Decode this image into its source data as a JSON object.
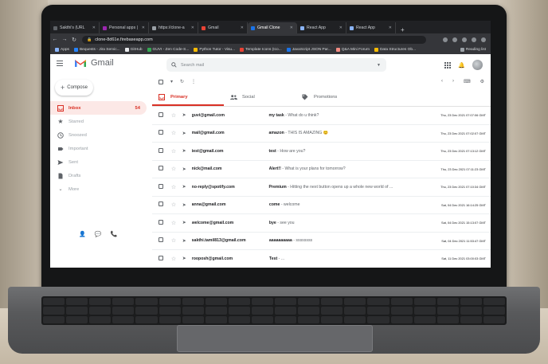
{
  "browser": {
    "tabs": [
      {
        "title": "Sakthi's (URL",
        "color": "#5f6368"
      },
      {
        "title": "Personal apps |",
        "color": "#9c27b0"
      },
      {
        "title": "https://clone-a",
        "color": "#9aa0a6"
      },
      {
        "title": "Gmail",
        "color": "#ea4335"
      },
      {
        "title": "Gmail Clone",
        "color": "#1a73e8"
      },
      {
        "title": "React App",
        "color": "#8ab4f8"
      },
      {
        "title": "React App",
        "color": "#8ab4f8"
      }
    ],
    "active_tab_index": 4,
    "new_tab_label": "+",
    "url": "clone-8d61e.firebaseapp.com",
    "bookmarks": [
      {
        "label": "Apps",
        "color": "#8ab4f8"
      },
      {
        "label": "Bequests - Jira Servic...",
        "color": "#2684ff"
      },
      {
        "label": "GitHub",
        "color": "#e8eaed"
      },
      {
        "label": "GUVI - Zen Code-S...",
        "color": "#34a853"
      },
      {
        "label": "Python Tutor - Visu...",
        "color": "#fbbc04"
      },
      {
        "label": "Template Icons (Ico...",
        "color": "#ea4335"
      },
      {
        "label": "JavaScript JSON Par...",
        "color": "#1a73e8"
      },
      {
        "label": "Q&A Mini Forum",
        "color": "#f28b82"
      },
      {
        "label": "Data Structures Ob...",
        "color": "#fbbc04"
      }
    ],
    "reading_list": "Reading list"
  },
  "header": {
    "logo_text": "Gmail",
    "search_placeholder": "Search mail"
  },
  "sidebar": {
    "compose_label": "Compose",
    "items": [
      {
        "label": "Inbox",
        "count": "54",
        "icon": "inbox-icon",
        "active": true
      },
      {
        "label": "Starred",
        "count": "",
        "icon": "star-icon",
        "active": false
      },
      {
        "label": "Snoozed",
        "count": "",
        "icon": "clock-icon",
        "active": false
      },
      {
        "label": "Important",
        "count": "",
        "icon": "label-icon",
        "active": false
      },
      {
        "label": "Sent",
        "count": "",
        "icon": "send-icon",
        "active": false
      },
      {
        "label": "Drafts",
        "count": "",
        "icon": "draft-icon",
        "active": false
      },
      {
        "label": "More",
        "count": "",
        "icon": "chevron-down-icon",
        "active": false
      }
    ]
  },
  "tabs": [
    {
      "label": "Primary",
      "active": true
    },
    {
      "label": "Social",
      "active": false
    },
    {
      "label": "Promotions",
      "active": false
    }
  ],
  "emails": [
    {
      "from": "guvi@gmail.com",
      "subject": "my task",
      "snippet": "- What do u think?",
      "date": "Thu, 23 Dec 2021 07:07:06 GMT"
    },
    {
      "from": "mail@gmail.com",
      "subject": "amazon",
      "snippet": "- THIS IS AMAZING 😊",
      "date": "Thu, 23 Dec 2021 07:02:07 GMT"
    },
    {
      "from": "test@gmail.com",
      "subject": "test",
      "snippet": "- How are you?",
      "date": "Thu, 23 Dec 2021 07:13:12 GMT"
    },
    {
      "from": "nick@mail.com",
      "subject": "Alert!!",
      "snippet": "- What is your plans for tomorrow?",
      "date": "Thu, 23 Dec 2021 07:11:23 GMT"
    },
    {
      "from": "no-reply@spotify.com",
      "subject": "Premium",
      "snippet": "- Hitting the next button opens up a whole new world of ...",
      "date": "Thu, 23 Dec 2021 07:10:34 GMT"
    },
    {
      "from": "anna@gmail.com",
      "subject": "come",
      "snippet": "- welcome",
      "date": "Sat, 04 Dec 2021 16:14:25 GMT"
    },
    {
      "from": "welcome@gmail.com",
      "subject": "bye",
      "snippet": "- see you",
      "date": "Sat, 04 Dec 2021 15:13:07 GMT"
    },
    {
      "from": "sakthi.tamil813@gmail.com",
      "subject": "aaaaaaaaaa",
      "snippet": "- ssssssss",
      "date": "Sat, 04 Dec 2021 11:53:47 GMT"
    },
    {
      "from": "rooposh@gmail.com",
      "subject": "Test",
      "snippet": "- ...",
      "date": "Sat, 11 Dec 2021 03:00:03 GMT"
    }
  ],
  "colors": {
    "accent_red": "#d93025",
    "chrome_dark": "#202124",
    "inbox_active_bg": "#fce8e6"
  }
}
